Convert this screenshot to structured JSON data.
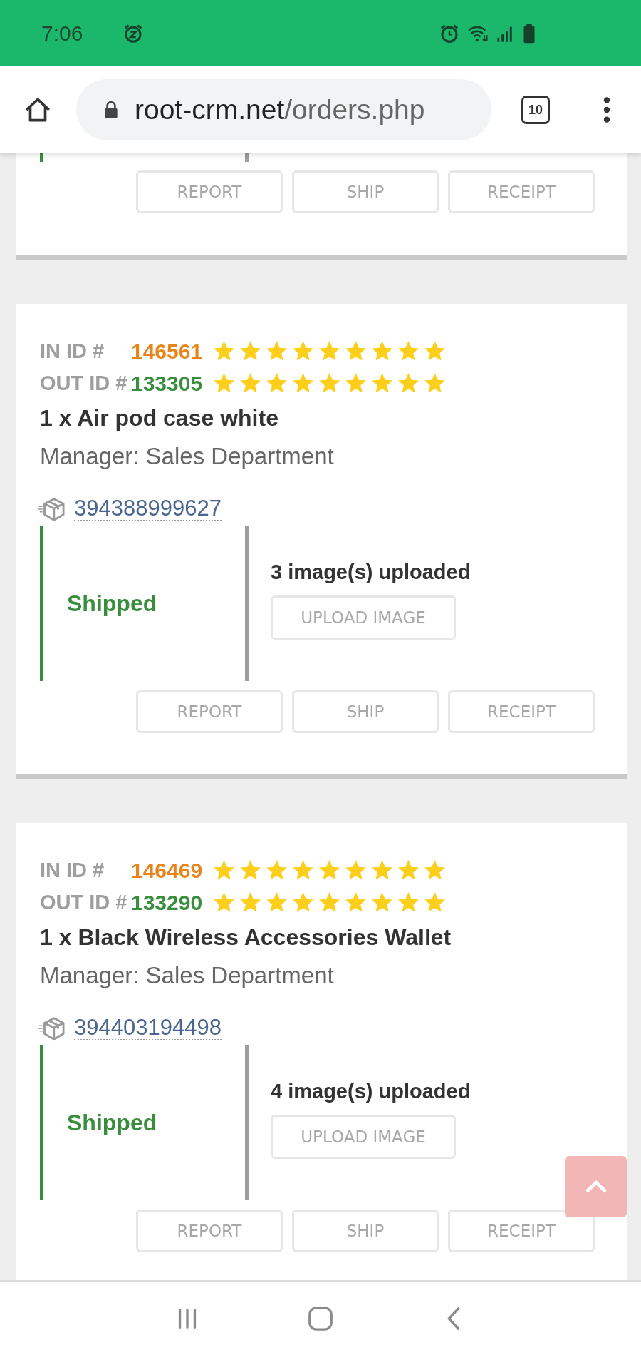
{
  "status_bar": {
    "time": "7:06"
  },
  "browser": {
    "url_host": "root-crm.net",
    "url_path": "/orders.php",
    "tab_count": "10"
  },
  "orders": [
    {
      "kind": "partial",
      "buttons": [
        {
          "label": "REPORT",
          "disabled": true
        },
        {
          "label": "SHIP",
          "disabled": true
        },
        {
          "label": "RECEIPT",
          "disabled": true
        }
      ]
    },
    {
      "kind": "full",
      "in_label": "IN ID #",
      "in_id": "146561",
      "in_rating": {
        "stars": 9
      },
      "out_label": "OUT ID #",
      "out_id": "133305",
      "out_rating": {
        "stars": 9
      },
      "title": "1 x Air pod case white",
      "manager": "Manager: Sales Department",
      "tracking": "394388999627",
      "status": "Shipped",
      "images": "3 image(s) uploaded",
      "upload_button": {
        "label": "UPLOAD IMAGE",
        "disabled": true
      },
      "buttons": [
        {
          "label": "REPORT",
          "disabled": true
        },
        {
          "label": "SHIP",
          "disabled": true
        },
        {
          "label": "RECEIPT",
          "disabled": true
        }
      ]
    },
    {
      "kind": "full",
      "in_label": "IN ID #",
      "in_id": "146469",
      "in_rating": {
        "stars": 9
      },
      "out_label": "OUT ID #",
      "out_id": "133290",
      "out_rating": {
        "stars": 9
      },
      "title": "1 x Black Wireless Accessories Wallet",
      "manager": "Manager: Sales Department",
      "tracking": "394403194498",
      "status": "Shipped",
      "images": "4 image(s) uploaded",
      "upload_button": {
        "label": "UPLOAD IMAGE",
        "disabled": true
      },
      "buttons": [
        {
          "label": "REPORT",
          "disabled": true
        },
        {
          "label": "SHIP",
          "disabled": true
        },
        {
          "label": "RECEIPT",
          "disabled": true
        }
      ]
    }
  ]
}
